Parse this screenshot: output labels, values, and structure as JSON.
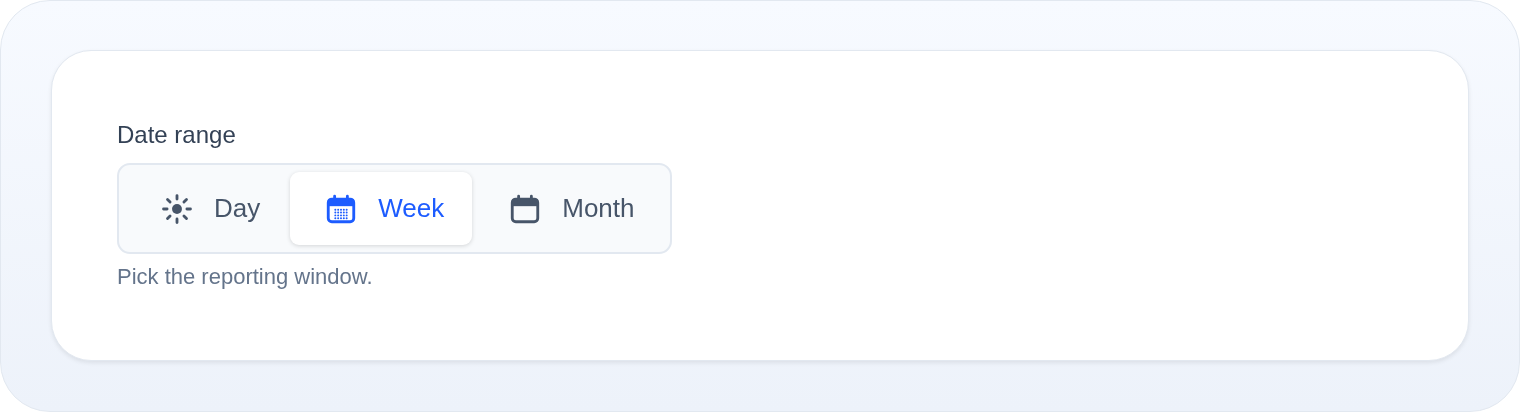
{
  "field": {
    "label": "Date range",
    "helper": "Pick the reporting window."
  },
  "options": [
    {
      "label": "Day",
      "selected": false
    },
    {
      "label": "Week",
      "selected": true
    },
    {
      "label": "Month",
      "selected": false
    }
  ]
}
